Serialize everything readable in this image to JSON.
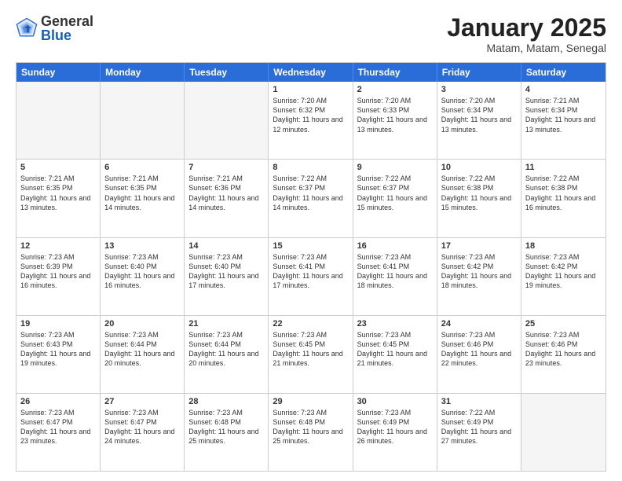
{
  "logo": {
    "general": "General",
    "blue": "Blue"
  },
  "title": {
    "month": "January 2025",
    "location": "Matam, Matam, Senegal"
  },
  "header_days": [
    "Sunday",
    "Monday",
    "Tuesday",
    "Wednesday",
    "Thursday",
    "Friday",
    "Saturday"
  ],
  "weeks": [
    [
      {
        "day": "",
        "text": "",
        "empty": true
      },
      {
        "day": "",
        "text": "",
        "empty": true
      },
      {
        "day": "",
        "text": "",
        "empty": true
      },
      {
        "day": "1",
        "text": "Sunrise: 7:20 AM\nSunset: 6:32 PM\nDaylight: 11 hours and 12 minutes.",
        "empty": false
      },
      {
        "day": "2",
        "text": "Sunrise: 7:20 AM\nSunset: 6:33 PM\nDaylight: 11 hours and 13 minutes.",
        "empty": false
      },
      {
        "day": "3",
        "text": "Sunrise: 7:20 AM\nSunset: 6:34 PM\nDaylight: 11 hours and 13 minutes.",
        "empty": false
      },
      {
        "day": "4",
        "text": "Sunrise: 7:21 AM\nSunset: 6:34 PM\nDaylight: 11 hours and 13 minutes.",
        "empty": false
      }
    ],
    [
      {
        "day": "5",
        "text": "Sunrise: 7:21 AM\nSunset: 6:35 PM\nDaylight: 11 hours and 13 minutes.",
        "empty": false
      },
      {
        "day": "6",
        "text": "Sunrise: 7:21 AM\nSunset: 6:35 PM\nDaylight: 11 hours and 14 minutes.",
        "empty": false
      },
      {
        "day": "7",
        "text": "Sunrise: 7:21 AM\nSunset: 6:36 PM\nDaylight: 11 hours and 14 minutes.",
        "empty": false
      },
      {
        "day": "8",
        "text": "Sunrise: 7:22 AM\nSunset: 6:37 PM\nDaylight: 11 hours and 14 minutes.",
        "empty": false
      },
      {
        "day": "9",
        "text": "Sunrise: 7:22 AM\nSunset: 6:37 PM\nDaylight: 11 hours and 15 minutes.",
        "empty": false
      },
      {
        "day": "10",
        "text": "Sunrise: 7:22 AM\nSunset: 6:38 PM\nDaylight: 11 hours and 15 minutes.",
        "empty": false
      },
      {
        "day": "11",
        "text": "Sunrise: 7:22 AM\nSunset: 6:38 PM\nDaylight: 11 hours and 16 minutes.",
        "empty": false
      }
    ],
    [
      {
        "day": "12",
        "text": "Sunrise: 7:23 AM\nSunset: 6:39 PM\nDaylight: 11 hours and 16 minutes.",
        "empty": false
      },
      {
        "day": "13",
        "text": "Sunrise: 7:23 AM\nSunset: 6:40 PM\nDaylight: 11 hours and 16 minutes.",
        "empty": false
      },
      {
        "day": "14",
        "text": "Sunrise: 7:23 AM\nSunset: 6:40 PM\nDaylight: 11 hours and 17 minutes.",
        "empty": false
      },
      {
        "day": "15",
        "text": "Sunrise: 7:23 AM\nSunset: 6:41 PM\nDaylight: 11 hours and 17 minutes.",
        "empty": false
      },
      {
        "day": "16",
        "text": "Sunrise: 7:23 AM\nSunset: 6:41 PM\nDaylight: 11 hours and 18 minutes.",
        "empty": false
      },
      {
        "day": "17",
        "text": "Sunrise: 7:23 AM\nSunset: 6:42 PM\nDaylight: 11 hours and 18 minutes.",
        "empty": false
      },
      {
        "day": "18",
        "text": "Sunrise: 7:23 AM\nSunset: 6:42 PM\nDaylight: 11 hours and 19 minutes.",
        "empty": false
      }
    ],
    [
      {
        "day": "19",
        "text": "Sunrise: 7:23 AM\nSunset: 6:43 PM\nDaylight: 11 hours and 19 minutes.",
        "empty": false
      },
      {
        "day": "20",
        "text": "Sunrise: 7:23 AM\nSunset: 6:44 PM\nDaylight: 11 hours and 20 minutes.",
        "empty": false
      },
      {
        "day": "21",
        "text": "Sunrise: 7:23 AM\nSunset: 6:44 PM\nDaylight: 11 hours and 20 minutes.",
        "empty": false
      },
      {
        "day": "22",
        "text": "Sunrise: 7:23 AM\nSunset: 6:45 PM\nDaylight: 11 hours and 21 minutes.",
        "empty": false
      },
      {
        "day": "23",
        "text": "Sunrise: 7:23 AM\nSunset: 6:45 PM\nDaylight: 11 hours and 21 minutes.",
        "empty": false
      },
      {
        "day": "24",
        "text": "Sunrise: 7:23 AM\nSunset: 6:46 PM\nDaylight: 11 hours and 22 minutes.",
        "empty": false
      },
      {
        "day": "25",
        "text": "Sunrise: 7:23 AM\nSunset: 6:46 PM\nDaylight: 11 hours and 23 minutes.",
        "empty": false
      }
    ],
    [
      {
        "day": "26",
        "text": "Sunrise: 7:23 AM\nSunset: 6:47 PM\nDaylight: 11 hours and 23 minutes.",
        "empty": false
      },
      {
        "day": "27",
        "text": "Sunrise: 7:23 AM\nSunset: 6:47 PM\nDaylight: 11 hours and 24 minutes.",
        "empty": false
      },
      {
        "day": "28",
        "text": "Sunrise: 7:23 AM\nSunset: 6:48 PM\nDaylight: 11 hours and 25 minutes.",
        "empty": false
      },
      {
        "day": "29",
        "text": "Sunrise: 7:23 AM\nSunset: 6:48 PM\nDaylight: 11 hours and 25 minutes.",
        "empty": false
      },
      {
        "day": "30",
        "text": "Sunrise: 7:23 AM\nSunset: 6:49 PM\nDaylight: 11 hours and 26 minutes.",
        "empty": false
      },
      {
        "day": "31",
        "text": "Sunrise: 7:22 AM\nSunset: 6:49 PM\nDaylight: 11 hours and 27 minutes.",
        "empty": false
      },
      {
        "day": "",
        "text": "",
        "empty": true
      }
    ]
  ]
}
